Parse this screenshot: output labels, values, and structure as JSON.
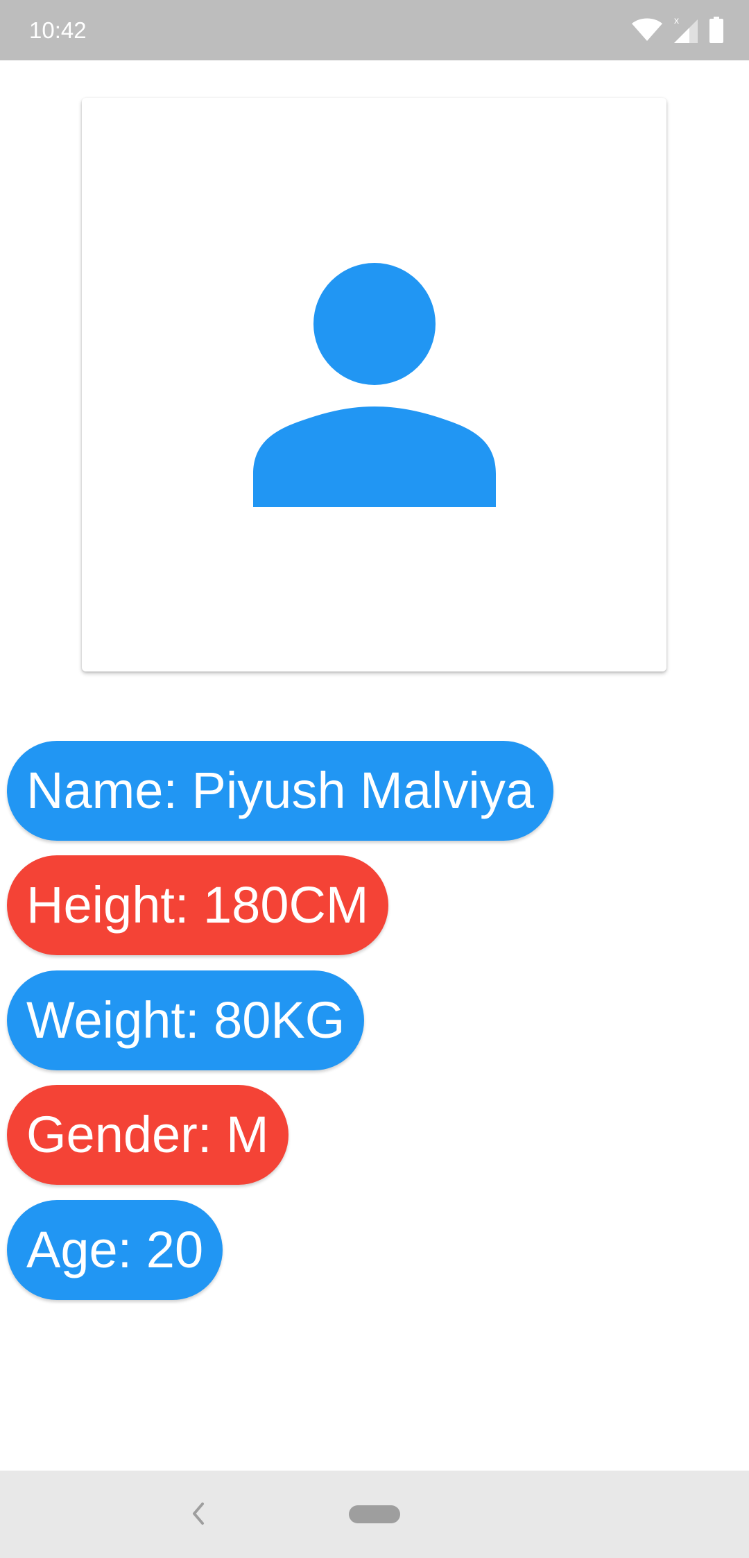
{
  "status_bar": {
    "time": "10:42",
    "icons": [
      "wifi-icon",
      "signal-icon",
      "battery-icon"
    ]
  },
  "profile": {
    "avatar_icon": "person-icon",
    "avatar_color": "#2196F3"
  },
  "details": [
    {
      "label": "Name: Piyush Malviya",
      "color": "#2196F3"
    },
    {
      "label": "Height: 180CM",
      "color": "#F44336"
    },
    {
      "label": "Weight: 80KG",
      "color": "#2196F3"
    },
    {
      "label": "Gender: M",
      "color": "#F44336"
    },
    {
      "label": "Age: 20",
      "color": "#2196F3"
    }
  ],
  "nav_bar": {
    "back_icon": "chevron-left-icon",
    "home_icon": "home-pill-icon"
  }
}
